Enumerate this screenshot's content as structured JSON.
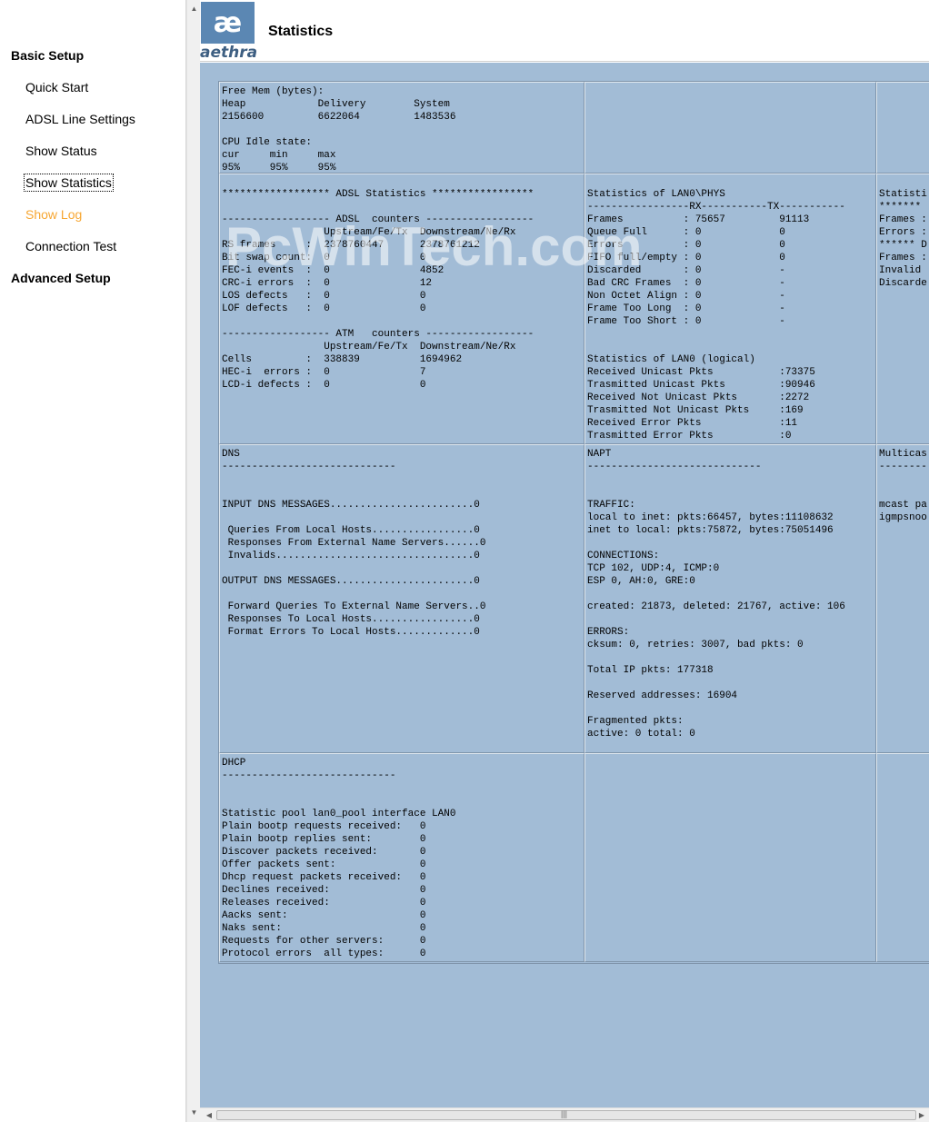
{
  "nav": {
    "basic_setup": "Basic Setup",
    "items": [
      {
        "label": "Quick Start"
      },
      {
        "label": "ADSL Line Settings"
      },
      {
        "label": "Show Status"
      },
      {
        "label": "Show Statistics"
      },
      {
        "label": "Show Log"
      },
      {
        "label": "Connection Test"
      }
    ],
    "advanced_setup": "Advanced Setup",
    "active_color": "#f7a733"
  },
  "header": {
    "logo_text": "aethra",
    "title": "Statistics"
  },
  "stats": {
    "memory": "Free Mem (bytes):\nHeap            Delivery        System\n2156600         6622064         1483536\n\nCPU Idle state:\ncur     min     max\n95%     95%     95%",
    "adsl": "****************** ADSL Statistics *****************\n\n------------------ ADSL  counters ------------------\n                 Upstream/Fe/Tx  Downstream/Ne/Rx\nRS frames     :  2378760447      2378761212\nBit swap count:  0               0\nFEC-i events  :  0               4852\nCRC-i errors  :  0               12\nLOS defects   :  0               0\nLOF defects   :  0               0\n\n------------------ ATM   counters ------------------\n                 Upstream/Fe/Tx  Downstream/Ne/Rx\nCells         :  338839          1694962\nHEC-i  errors :  0               7\nLCD-i defects :  0               0",
    "lan_phys": "Statistics of LAN0\\PHYS\n-----------------RX-----------TX-----------\nFrames          : 75657         91113\nQueue Full      : 0             0\nErrors          : 0             0\nFIFO full/empty : 0             0\nDiscarded       : 0             -\nBad CRC Frames  : 0             -\nNon Octet Align : 0             -\nFrame Too Long  : 0             -\nFrame Too Short : 0             -\n\n\nStatistics of LAN0 (logical)\nReceived Unicast Pkts           :73375\nTrasmitted Unicast Pkts         :90946\nReceived Not Unicast Pkts       :2272\nTrasmitted Not Unicast Pkts     :169\nReceived Error Pkts             :11\nTrasmitted Error Pkts           :0",
    "col3_row2": "Statisti\n*******\nFrames :\nErrors :\n****** D\nFrames :\nInvalid\nDiscarde",
    "dns": "DNS\n-----------------------------\n\n\nINPUT DNS MESSAGES........................0\n\n Queries From Local Hosts.................0\n Responses From External Name Servers......0\n Invalids.................................0\n\nOUTPUT DNS MESSAGES.......................0\n\n Forward Queries To External Name Servers..0\n Responses To Local Hosts.................0\n Format Errors To Local Hosts.............0",
    "napt": "NAPT\n-----------------------------\n\n\nTRAFFIC:\nlocal to inet: pkts:66457, bytes:11108632\ninet to local: pkts:75872, bytes:75051496\n\nCONNECTIONS:\nTCP 102, UDP:4, ICMP:0\nESP 0, AH:0, GRE:0\n\ncreated: 21873, deleted: 21767, active: 106\n\nERRORS:\ncksum: 0, retries: 3007, bad pkts: 0\n\nTotal IP pkts: 177318\n\nReserved addresses: 16904\n\nFragmented pkts:\nactive: 0 total: 0",
    "multicast": "Multicas\n--------\n\n\nmcast pa\nigmpsnoo",
    "dhcp": "DHCP\n-----------------------------\n\n\nStatistic pool lan0_pool interface LAN0\nPlain bootp requests received:   0\nPlain bootp replies sent:        0\nDiscover packets received:       0\nOffer packets sent:              0\nDhcp request packets received:   0\nDeclines received:               0\nReleases received:               0\nAacks sent:                      0\nNaks sent:                       0\nRequests for other servers:      0\nProtocol errors  all types:      0",
    "watermark": "PcWinTech.com"
  },
  "colors": {
    "content_bg": "#a2bcd6",
    "logo_blue": "#5b87b3"
  }
}
